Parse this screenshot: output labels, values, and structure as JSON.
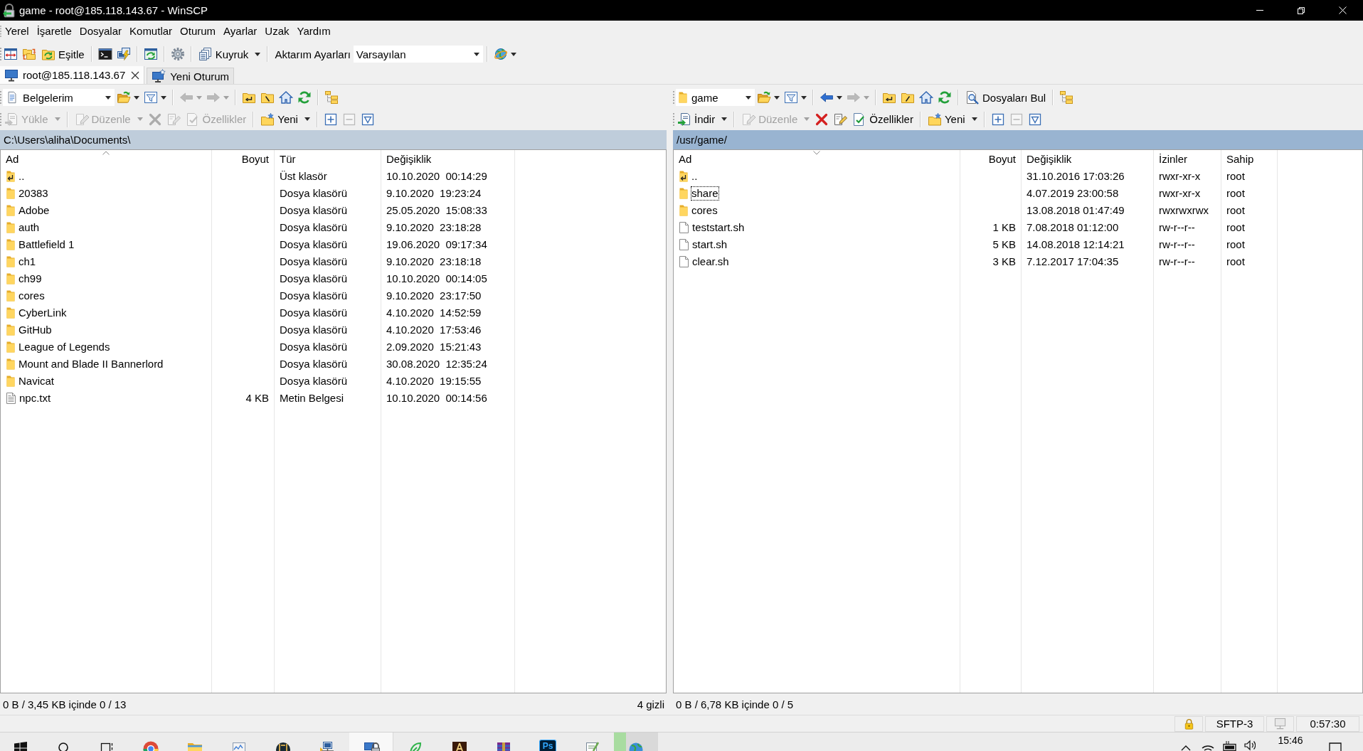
{
  "window": {
    "title": "game - root@185.118.143.67 - WinSCP"
  },
  "menu": [
    "Yerel",
    "İşaretle",
    "Dosyalar",
    "Komutlar",
    "Oturum",
    "Ayarlar",
    "Uzak",
    "Yardım"
  ],
  "toolbar": {
    "synchronize_label": "Eşitle",
    "queue_label": "Kuyruk",
    "transfer_settings": {
      "label": "Aktarım Ayarları",
      "value": "Varsayılan"
    }
  },
  "session_tabs": [
    {
      "kind": "session",
      "label": "root@185.118.143.67",
      "selected": true
    },
    {
      "kind": "new_session",
      "label": "Yeni Oturum",
      "selected": false
    }
  ],
  "local_panel": {
    "active": false,
    "toolbar": [
      {
        "kind": "location",
        "label": "Belgelerim",
        "disabled": false
      },
      {
        "kind": "open_directory",
        "disabled": false
      },
      {
        "kind": "filter",
        "disabled": false
      },
      {
        "kind": "back",
        "disabled": true
      },
      {
        "kind": "forward",
        "disabled": true
      },
      {
        "kind": "parent_directory",
        "disabled": false
      },
      {
        "kind": "root_directory",
        "disabled": false
      },
      {
        "kind": "home_directory",
        "disabled": false
      },
      {
        "kind": "refresh",
        "disabled": false
      },
      {
        "kind": "tree",
        "disabled": false
      }
    ],
    "actions": [
      {
        "kind": "upload",
        "label": "Yükle",
        "disabled": true
      },
      {
        "kind": "edit",
        "label": "Düzenle",
        "disabled": true
      },
      {
        "kind": "delete",
        "disabled": true
      },
      {
        "kind": "rename",
        "disabled": true
      },
      {
        "kind": "properties",
        "label": "Özellikler",
        "disabled": true
      },
      {
        "kind": "new",
        "label": "Yeni",
        "disabled": false
      },
      {
        "kind": "select_mask",
        "disabled": false
      },
      {
        "kind": "unselect_mask",
        "disabled": true
      },
      {
        "kind": "select_filter",
        "disabled": false
      }
    ],
    "path": "C:\\Users\\aliha\\Documents\\",
    "columns": [
      {
        "label": "Ad",
        "sorted": true,
        "descending": false
      },
      {
        "label": "Boyut",
        "sorted": false
      },
      {
        "label": "Tür",
        "sorted": false
      },
      {
        "label": "Değişiklik",
        "sorted": false
      }
    ],
    "rows": [
      {
        "kind": "parent",
        "name": "..",
        "type": "Üst klasör",
        "modified": "10.10.2020  00:14:29",
        "focused": false
      },
      {
        "kind": "folder",
        "name": "20383",
        "type": "Dosya klasörü",
        "modified": "9.10.2020  19:23:24",
        "focused": false
      },
      {
        "kind": "folder",
        "name": "Adobe",
        "type": "Dosya klasörü",
        "modified": "25.05.2020  15:08:33",
        "focused": false
      },
      {
        "kind": "folder",
        "name": "auth",
        "type": "Dosya klasörü",
        "modified": "9.10.2020  23:18:28",
        "focused": false
      },
      {
        "kind": "folder",
        "name": "Battlefield 1",
        "type": "Dosya klasörü",
        "modified": "19.06.2020  09:17:34",
        "focused": false
      },
      {
        "kind": "folder",
        "name": "ch1",
        "type": "Dosya klasörü",
        "modified": "9.10.2020  23:18:18",
        "focused": false
      },
      {
        "kind": "folder",
        "name": "ch99",
        "type": "Dosya klasörü",
        "modified": "10.10.2020  00:14:05",
        "focused": false
      },
      {
        "kind": "folder",
        "name": "cores",
        "type": "Dosya klasörü",
        "modified": "9.10.2020  23:17:50",
        "focused": false
      },
      {
        "kind": "folder",
        "name": "CyberLink",
        "type": "Dosya klasörü",
        "modified": "4.10.2020  14:52:59",
        "focused": false
      },
      {
        "kind": "folder",
        "name": "GitHub",
        "type": "Dosya klasörü",
        "modified": "4.10.2020  17:53:46",
        "focused": false
      },
      {
        "kind": "folder",
        "name": "League of Legends",
        "type": "Dosya klasörü",
        "modified": "2.09.2020  15:21:43",
        "focused": false
      },
      {
        "kind": "folder",
        "name": "Mount and Blade II Bannerlord",
        "type": "Dosya klasörü",
        "modified": "30.08.2020  12:35:24",
        "focused": false
      },
      {
        "kind": "folder",
        "name": "Navicat",
        "type": "Dosya klasörü",
        "modified": "4.10.2020  19:15:55",
        "focused": false
      },
      {
        "kind": "text_file",
        "name": "npc.txt",
        "size": "4 KB",
        "type": "Metin Belgesi",
        "modified": "10.10.2020  00:14:56",
        "focused": false
      }
    ],
    "status": "0 B / 3,45 KB içinde 0 / 13",
    "hidden_count": "4 gizli"
  },
  "remote_panel": {
    "active": true,
    "toolbar": [
      {
        "kind": "location",
        "label": "game",
        "disabled": false
      },
      {
        "kind": "open_directory",
        "disabled": false
      },
      {
        "kind": "filter",
        "disabled": false
      },
      {
        "kind": "back",
        "disabled": false
      },
      {
        "kind": "forward",
        "disabled": true
      },
      {
        "kind": "parent_directory",
        "disabled": false
      },
      {
        "kind": "root_directory",
        "disabled": false
      },
      {
        "kind": "home_directory",
        "disabled": false
      },
      {
        "kind": "refresh",
        "disabled": false
      },
      {
        "kind": "find",
        "label": "Dosyaları Bul",
        "disabled": false
      },
      {
        "kind": "tree",
        "disabled": false
      }
    ],
    "actions": [
      {
        "kind": "download",
        "label": "İndir",
        "disabled": false
      },
      {
        "kind": "edit",
        "label": "Düzenle",
        "disabled": true
      },
      {
        "kind": "delete",
        "disabled": false
      },
      {
        "kind": "rename",
        "disabled": false
      },
      {
        "kind": "properties",
        "label": "Özellikler",
        "disabled": false
      },
      {
        "kind": "new",
        "label": "Yeni",
        "disabled": false
      },
      {
        "kind": "select_mask",
        "disabled": false
      },
      {
        "kind": "unselect_mask",
        "disabled": true
      },
      {
        "kind": "select_filter",
        "disabled": false
      }
    ],
    "path": "/usr/game/",
    "columns": [
      {
        "label": "Ad",
        "sorted": true,
        "descending": true
      },
      {
        "label": "Boyut",
        "sorted": false
      },
      {
        "label": "Değişiklik",
        "sorted": false
      },
      {
        "label": "İzinler",
        "sorted": false
      },
      {
        "label": "Sahip",
        "sorted": false
      }
    ],
    "rows": [
      {
        "kind": "parent",
        "name": "..",
        "modified": "31.10.2016 17:03:26",
        "permissions": "rwxr-xr-x",
        "owner": "root",
        "focused": false
      },
      {
        "kind": "folder",
        "name": "share",
        "modified": "4.07.2019 23:00:58",
        "permissions": "rwxr-xr-x",
        "owner": "root",
        "focused": true
      },
      {
        "kind": "folder",
        "name": "cores",
        "modified": "13.08.2018 01:47:49",
        "permissions": "rwxrwxrwx",
        "owner": "root",
        "focused": false
      },
      {
        "kind": "file",
        "name": "teststart.sh",
        "size": "1 KB",
        "modified": "7.08.2018 01:12:00",
        "permissions": "rw-r--r--",
        "owner": "root",
        "focused": false
      },
      {
        "kind": "file",
        "name": "start.sh",
        "size": "5 KB",
        "modified": "14.08.2018 12:14:21",
        "permissions": "rw-r--r--",
        "owner": "root",
        "focused": false
      },
      {
        "kind": "file",
        "name": "clear.sh",
        "size": "3 KB",
        "modified": "7.12.2017 17:04:35",
        "permissions": "rw-r--r--",
        "owner": "root",
        "focused": false
      }
    ],
    "status": "0 B / 6,78 KB içinde 0 / 5"
  },
  "status_bar": {
    "protocol": "SFTP-3",
    "elapsed": "0:57:30"
  },
  "taskbar": {
    "apps": [
      {
        "kind": "browser",
        "active": false
      },
      {
        "kind": "file_explorer",
        "active": false
      },
      {
        "kind": "chart",
        "active": false
      },
      {
        "kind": "game",
        "active": false
      },
      {
        "kind": "network",
        "active": false
      },
      {
        "kind": "sftp_client",
        "active": true
      },
      {
        "kind": "leaf",
        "active": false
      },
      {
        "kind": "tile_game",
        "active": false
      },
      {
        "kind": "archive",
        "active": false
      },
      {
        "kind": "image_editor",
        "label": "Ps",
        "active": false
      },
      {
        "kind": "editor",
        "active": false
      },
      {
        "kind": "globe",
        "active": false,
        "level": 0.27
      }
    ],
    "clock": "15:46"
  }
}
